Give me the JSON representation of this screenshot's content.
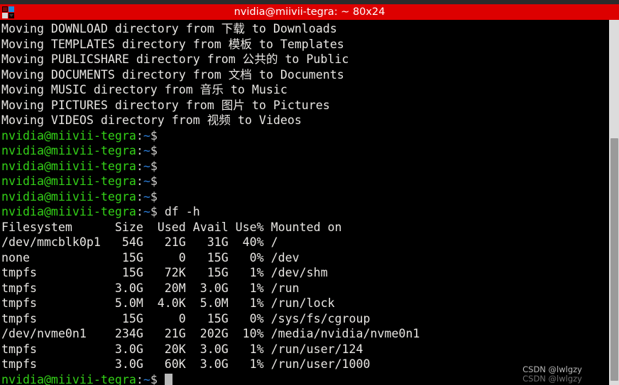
{
  "window": {
    "title": "nvidia@miivii-tegra: ~ 80x24",
    "icon": "terminal-window-icon",
    "titlebar_color": "#dd0000",
    "title_text_color": "#ffffff",
    "background_color": "#000000"
  },
  "terminal": {
    "prompt": {
      "user_host": "nvidia@miivii-tegra",
      "colon": ":",
      "path": "~",
      "sigil": "$",
      "user_host_color": "#33d017",
      "path_color": "#2a7bd6",
      "sigil_color": "#d0cfcc"
    },
    "move_lines": [
      "Moving DOWNLOAD directory from 下载 to Downloads",
      "Moving TEMPLATES directory from 模板 to Templates",
      "Moving PUBLICSHARE directory from 公共的 to Public",
      "Moving DOCUMENTS directory from 文档 to Documents",
      "Moving MUSIC directory from 音乐 to Music",
      "Moving PICTURES directory from 图片 to Pictures",
      "Moving VIDEOS directory from 视频 to Videos"
    ],
    "empty_prompt_count": 5,
    "command": "df -h",
    "df_header": "Filesystem      Size  Used Avail Use% Mounted on",
    "df_rows": [
      "/dev/mmcblk0p1   54G   21G   31G  40% /",
      "none             15G     0   15G   0% /dev",
      "tmpfs            15G   72K   15G   1% /dev/shm",
      "tmpfs           3.0G   20M  3.0G   1% /run",
      "tmpfs           5.0M  4.0K  5.0M   1% /run/lock",
      "tmpfs            15G     0   15G   0% /sys/fs/cgroup",
      "/dev/nvme0n1    234G   21G  202G  10% /media/nvidia/nvme0n1",
      "tmpfs           3.0G   20K  3.0G   1% /run/user/124",
      "tmpfs           3.0G   60K  3.0G   1% /run/user/1000"
    ],
    "df_table": {
      "columns": [
        "Filesystem",
        "Size",
        "Used",
        "Avail",
        "Use%",
        "Mounted on"
      ],
      "rows": [
        [
          "/dev/mmcblk0p1",
          "54G",
          "21G",
          "31G",
          "40%",
          "/"
        ],
        [
          "none",
          "15G",
          "0",
          "15G",
          "0%",
          "/dev"
        ],
        [
          "tmpfs",
          "15G",
          "72K",
          "15G",
          "1%",
          "/dev/shm"
        ],
        [
          "tmpfs",
          "3.0G",
          "20M",
          "3.0G",
          "1%",
          "/run"
        ],
        [
          "tmpfs",
          "5.0M",
          "4.0K",
          "5.0M",
          "1%",
          "/run/lock"
        ],
        [
          "tmpfs",
          "15G",
          "0",
          "15G",
          "0%",
          "/sys/fs/cgroup"
        ],
        [
          "/dev/nvme0n1",
          "234G",
          "21G",
          "202G",
          "10%",
          "/media/nvidia/nvme0n1"
        ],
        [
          "tmpfs",
          "3.0G",
          "20K",
          "3.0G",
          "1%",
          "/run/user/124"
        ],
        [
          "tmpfs",
          "3.0G",
          "60K",
          "3.0G",
          "1%",
          "/run/user/1000"
        ]
      ]
    }
  },
  "scrollbar": {
    "track_color": "#dcdcdc",
    "thumb_color": "#9a9a9a"
  },
  "watermark": {
    "line1": "CSDN @lwlgzy",
    "line2": "CSDN @lwlgzy"
  }
}
